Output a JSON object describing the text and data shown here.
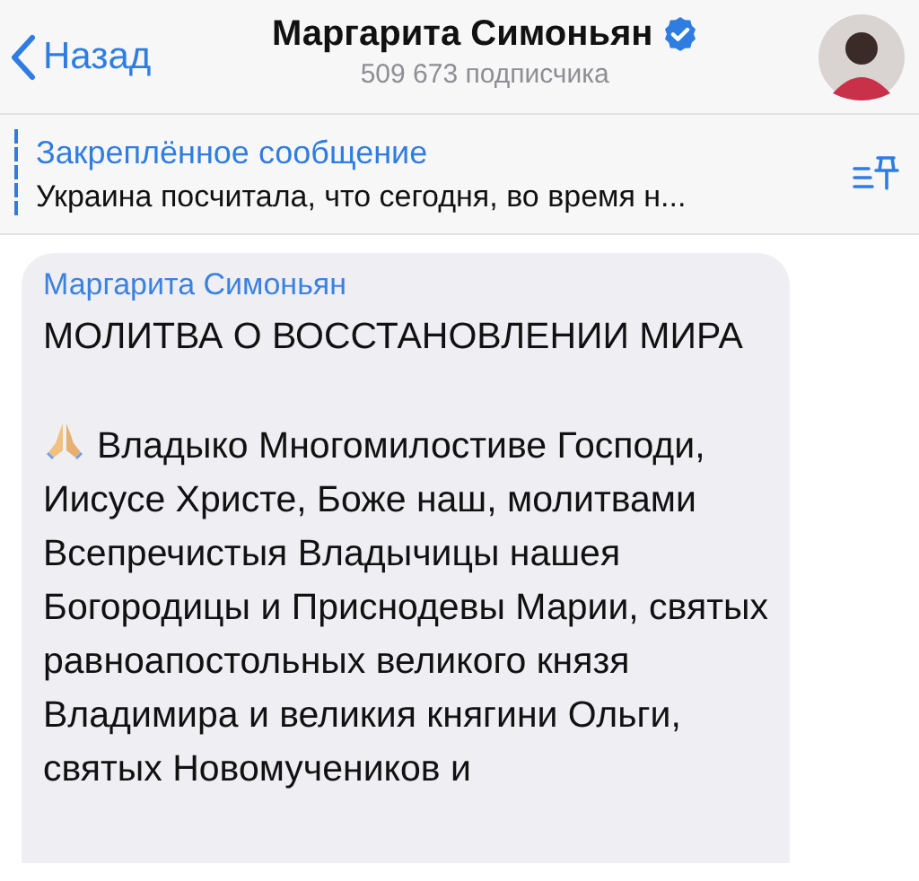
{
  "header": {
    "back_label": "Назад",
    "title": "Маргарита Симоньян",
    "verified": true,
    "subtitle": "509 673 подписчика"
  },
  "pinned": {
    "label": "Закреплённое сообщение",
    "text": "Украина посчитала, что сегодня, во время н..."
  },
  "message": {
    "sender": "Маргарита Симоньян",
    "title": "МОЛИТВА О ВОССТАНОВЛЕНИИ МИРА",
    "body": "Владыко Многомилостиве Господи, Иисусе Христе, Боже наш, молитвами Всепречистыя Владычицы нашея Богородицы и Приснодевы Марии, святых равноапостольных великого князя Владимира и великия княгини Ольги, святых Новомучеников и"
  }
}
